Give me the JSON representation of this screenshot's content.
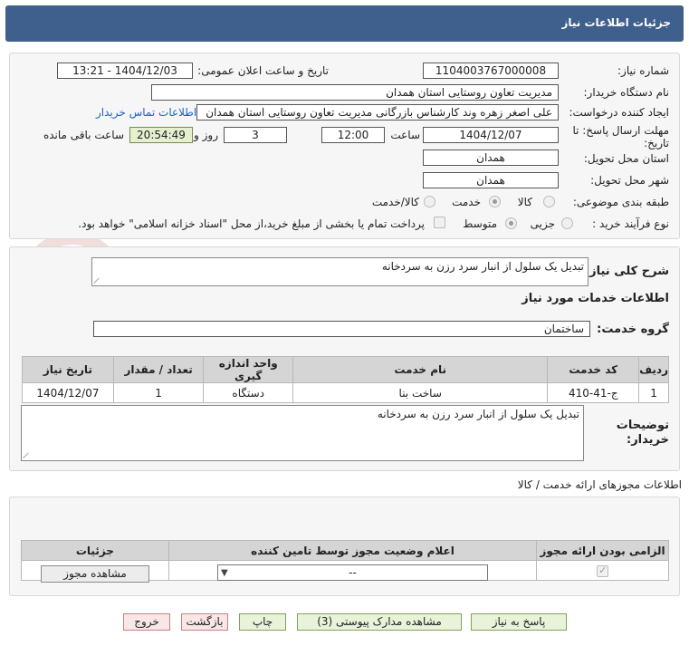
{
  "header": {
    "title": "جزئیات اطلاعات نیاز"
  },
  "watermark": {
    "text": "AriaTender.net"
  },
  "fields": {
    "need_number_label": "شماره نیاز:",
    "need_number": "1104003767000008",
    "announce_label": "تاریخ و ساعت اعلان عمومی:",
    "announce_value": "1404/12/03 - 13:21",
    "buyer_org_label": "نام دستگاه خریدار:",
    "buyer_org": "مدیریت تعاون روستایی استان همدان",
    "creator_label": "ایجاد کننده درخواست:",
    "creator": "علی اصغر زهره وند کارشناس بازرگانی مدیریت تعاون روستایی استان همدان",
    "buyer_contact_link": "اطلاعات تماس خریدار",
    "deadline_label": "مهلت ارسال پاسخ: تا تاریخ:",
    "deadline_date": "1404/12/07",
    "time_label": "ساعت",
    "deadline_time": "12:00",
    "days_value": "3",
    "days_label": "روز و",
    "remaining_time": "20:54:49",
    "remaining_label": "ساعت باقی مانده",
    "province_label": "استان محل تحویل:",
    "province": "همدان",
    "city_label": "شهر محل تحویل:",
    "city": "همدان",
    "category_label": "طبقه بندی موضوعی:",
    "category_options": [
      "کالا",
      "خدمت",
      "کالا/خدمت"
    ],
    "process_label": "نوع فرآیند خرید :",
    "process_options": [
      "جزیی",
      "متوسط"
    ],
    "payment_note": "پرداخت تمام یا بخشی از مبلغ خرید،از محل \"اسناد خزانه اسلامی\" خواهد بود."
  },
  "summary": {
    "general_desc_label": "شرح کلی نیاز:",
    "general_desc": "تبدیل یک سلول از انبار سرد رزن به سردخانه",
    "services_info_label": "اطلاعات خدمات مورد نیاز",
    "service_group_label": "گروه خدمت:",
    "service_group": "ساختمان",
    "buyer_notes_label": "توضیحات خریدار:",
    "buyer_notes": "تبدیل یک سلول از انبار سرد رزن به سردخانه"
  },
  "services_table": {
    "headers": [
      "ردیف",
      "کد خدمت",
      "نام خدمت",
      "واحد اندازه گیری",
      "تعداد / مقدار",
      "تاریخ نیاز"
    ],
    "rows": [
      [
        "1",
        "ج-41-410",
        "ساخت بنا",
        "دستگاه",
        "1",
        "1404/12/07"
      ]
    ]
  },
  "permits": {
    "section_title": "اطلاعات مجوزهای ارائه خدمت / کالا",
    "headers": [
      "الزامی بودن ارائه مجوز",
      "اعلام وضعیت مجوز توسط تامین کننده",
      "جزئیات"
    ],
    "select_value": "--",
    "view_button": "مشاهده مجوز"
  },
  "actions": {
    "reply": "پاسخ به نیاز",
    "attachments": "مشاهده مدارک پیوستی (3)",
    "print": "چاپ",
    "back": "بازگشت",
    "exit": "خروج"
  }
}
